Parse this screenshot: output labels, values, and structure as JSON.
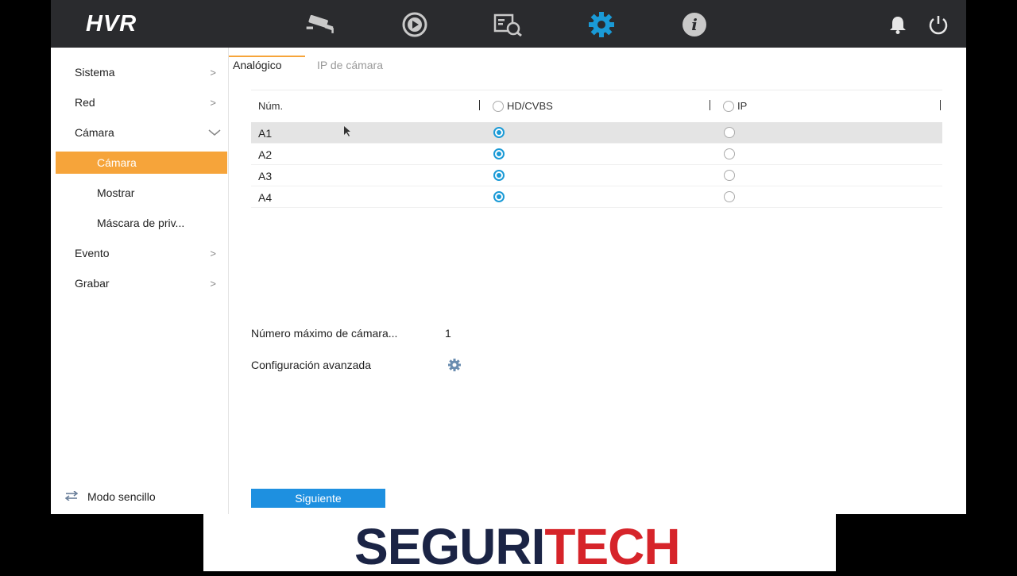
{
  "app": {
    "logo": "HVR"
  },
  "topbar": {
    "icons": [
      "camera-icon",
      "playback-icon",
      "search-icon",
      "settings-icon",
      "info-icon",
      "bell-icon",
      "power-icon"
    ],
    "accent": "#1a9ad6"
  },
  "sidebar": {
    "items": [
      {
        "label": "Sistema"
      },
      {
        "label": "Red"
      },
      {
        "label": "Cámara"
      },
      {
        "label": "Cámara"
      },
      {
        "label": "Mostrar"
      },
      {
        "label": "Máscara de priv..."
      },
      {
        "label": "Evento"
      },
      {
        "label": "Grabar"
      }
    ],
    "mode_label": "Modo sencillo",
    "active_color": "#f6a43a"
  },
  "tabs": [
    {
      "label": "Analógico",
      "active": true
    },
    {
      "label": "IP de cámara",
      "active": false
    }
  ],
  "table": {
    "headers": {
      "num": "Núm.",
      "hd": "HD/CVBS",
      "ip": "IP"
    },
    "rows": [
      {
        "num": "A1",
        "mode": "HD/CVBS"
      },
      {
        "num": "A2",
        "mode": "HD/CVBS"
      },
      {
        "num": "A3",
        "mode": "HD/CVBS"
      },
      {
        "num": "A4",
        "mode": "HD/CVBS"
      }
    ]
  },
  "fields": {
    "max_cameras_label": "Número máximo de cámara...",
    "max_cameras_value": "1",
    "advanced_label": "Configuración avanzada"
  },
  "buttons": {
    "next": "Siguiente"
  },
  "banner": {
    "part1": "SEGURI",
    "part2": "TECH"
  }
}
